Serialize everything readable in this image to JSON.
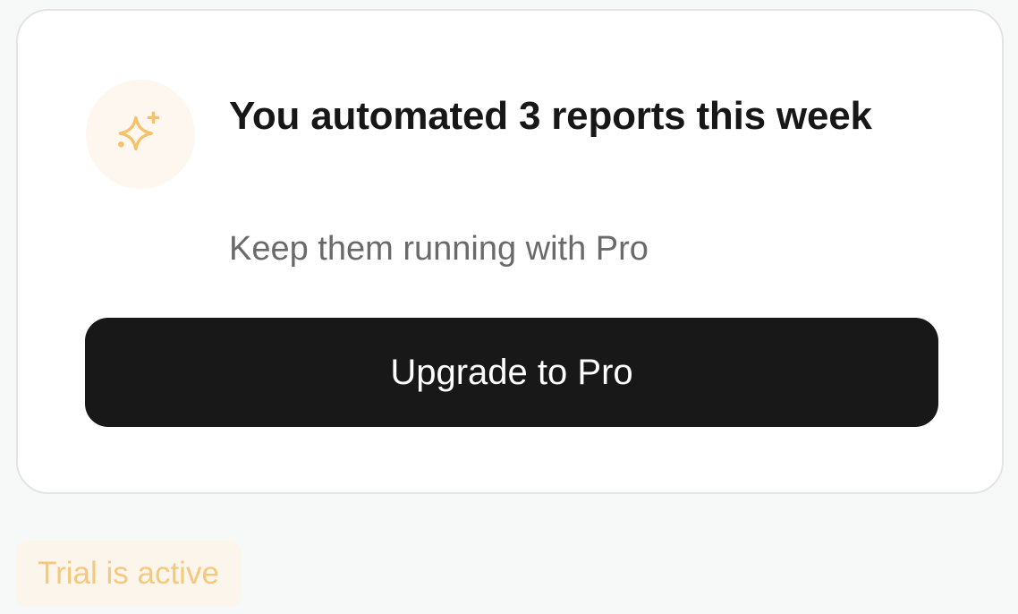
{
  "card": {
    "icon": "sparkles-icon",
    "title": "You automated 3 reports this week",
    "subtitle": "Keep them running with Pro",
    "cta_label": "Upgrade to Pro"
  },
  "badge": {
    "label": "Trial is active"
  },
  "colors": {
    "accent": "#f5c26b",
    "icon_bg": "#fdf7ef",
    "button_bg": "#181818",
    "badge_bg": "#fcf5eb",
    "badge_text": "#f5c97d"
  }
}
